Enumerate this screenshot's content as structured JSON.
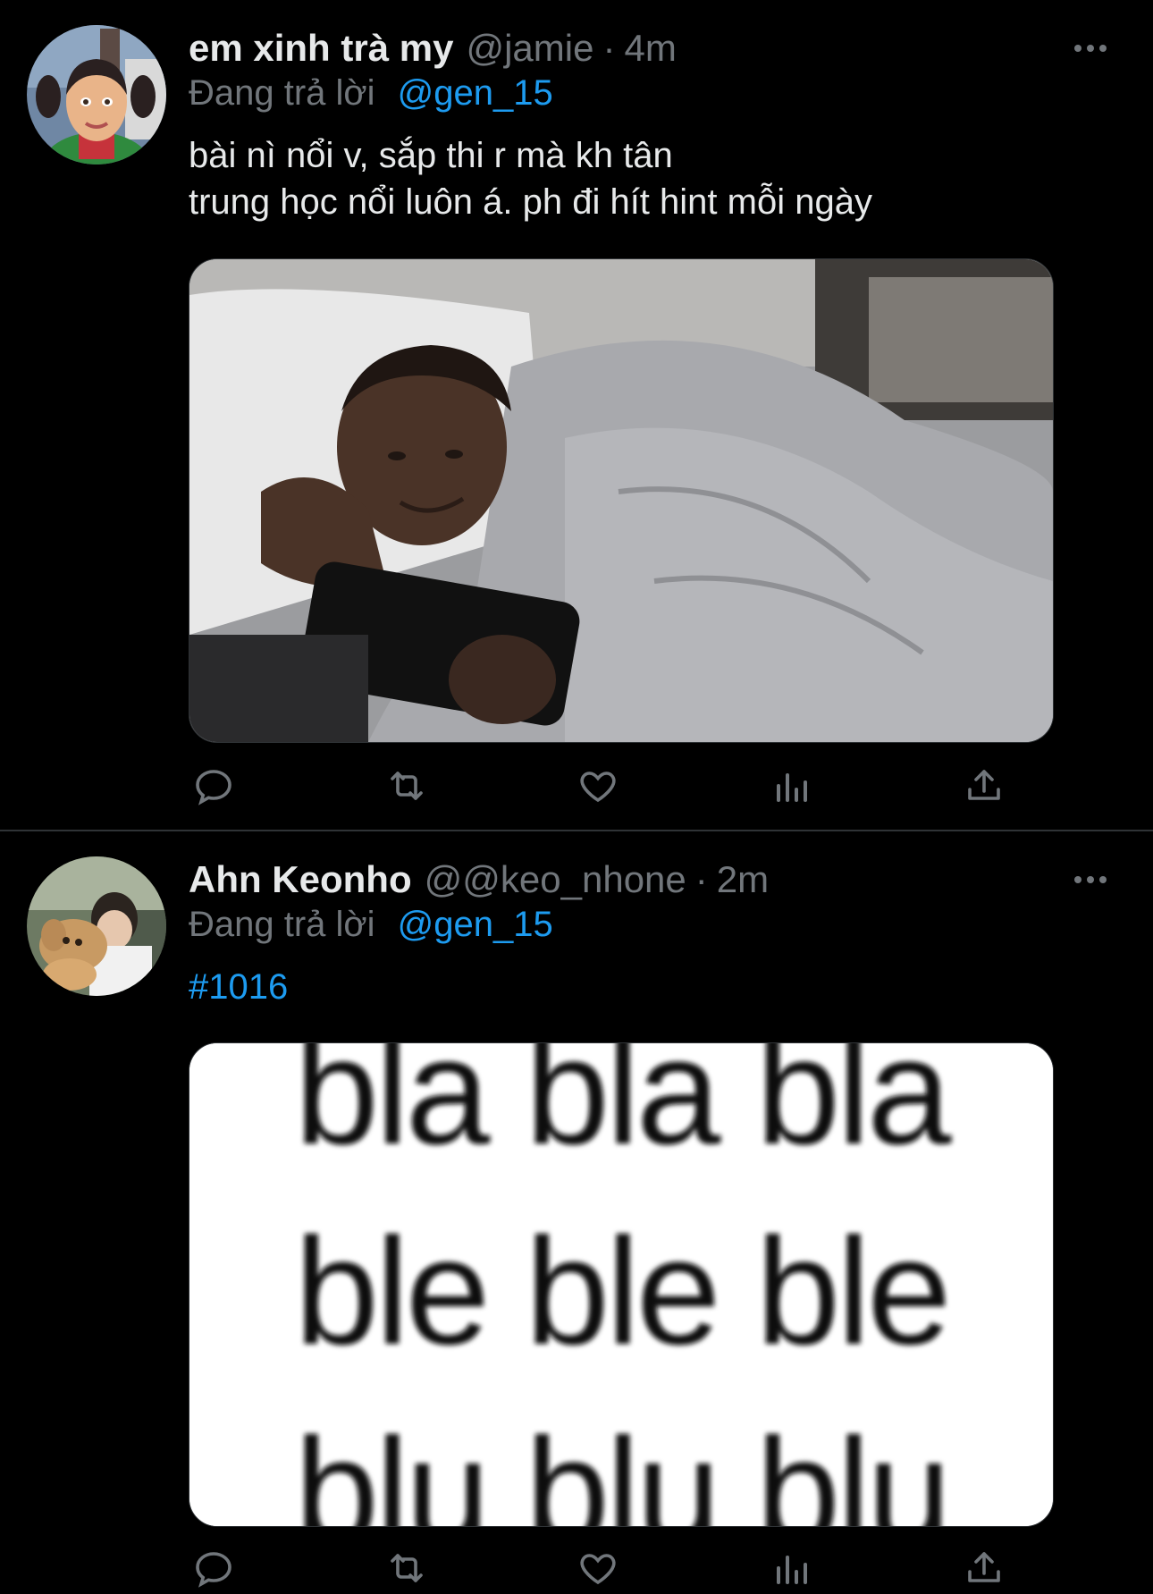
{
  "tweets": [
    {
      "display_name": "em xinh trà my",
      "handle": "@jamie",
      "separator": "·",
      "time": "4m",
      "reply_prefix": "Đang trả lời",
      "reply_to": "@gen_15",
      "text_lines": [
        "bài nì nổi v, sắp thi r mà kh tân",
        "trung học nổi luôn á. ph đi hít hint mỗi ngày"
      ],
      "avatar_icon": "cartoon-girl-avatar",
      "media_icon": "man-in-bed-with-phone-photo"
    },
    {
      "display_name": "Ahn Keonho",
      "handle": "@@keo_nhone",
      "separator": "·",
      "time": "2m",
      "reply_prefix": "Đang trả lời",
      "reply_to": "@gen_15",
      "hashtag": "#1016",
      "media_lines": [
        "bla bla bla",
        "ble ble ble",
        "blu blu blu"
      ],
      "avatar_icon": "person-with-plush-toy-avatar",
      "media_icon": "blurred-text-meme-image"
    }
  ],
  "actions": {
    "reply_icon": "reply-icon",
    "retweet_icon": "retweet-icon",
    "like_icon": "like-icon",
    "views_icon": "views-icon",
    "share_icon": "share-icon",
    "more_icon": "more-icon"
  },
  "colors": {
    "background": "#000000",
    "primary_text": "#e7e9ea",
    "secondary_text": "#71767b",
    "link": "#1d9bf0",
    "divider": "#2f3336"
  }
}
